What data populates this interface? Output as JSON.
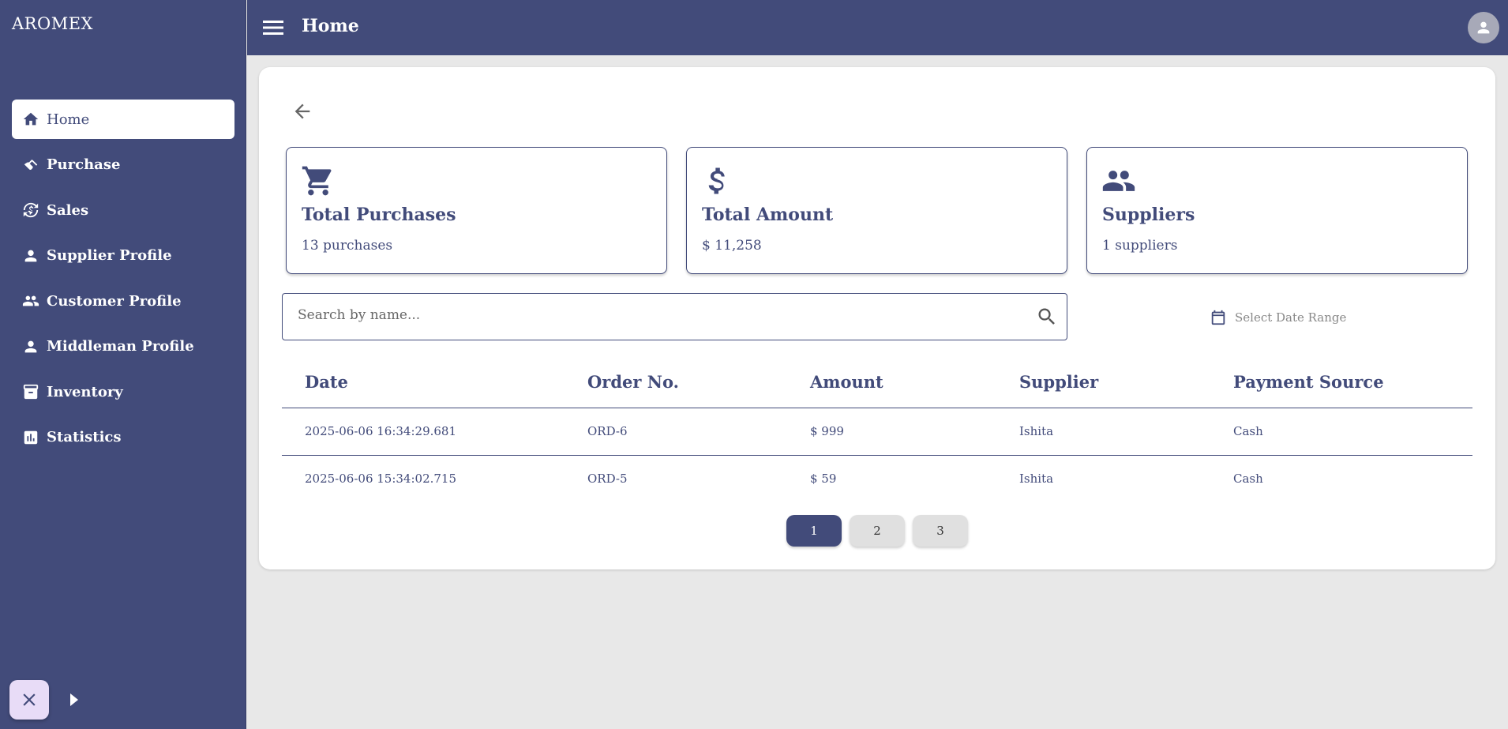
{
  "app": {
    "brand": "AROMEX"
  },
  "header": {
    "title": "Home"
  },
  "sidebar": {
    "items": [
      {
        "label": "Home",
        "icon": "home-icon",
        "active": true
      },
      {
        "label": "Purchase",
        "icon": "handshake-icon"
      },
      {
        "label": "Sales",
        "icon": "currency-exchange-icon"
      },
      {
        "label": "Supplier Profile",
        "icon": "person-icon"
      },
      {
        "label": "Customer Profile",
        "icon": "people-icon"
      },
      {
        "label": "Middleman Profile",
        "icon": "person-icon"
      },
      {
        "label": "Inventory",
        "icon": "inventory-icon"
      },
      {
        "label": "Statistics",
        "icon": "bar-chart-icon"
      }
    ]
  },
  "stats": [
    {
      "title": "Total Purchases",
      "value": "13 purchases",
      "icon": "cart-icon"
    },
    {
      "title": "Total Amount",
      "value": "$ 11,258",
      "icon": "dollar-icon"
    },
    {
      "title": "Suppliers",
      "value": "1 suppliers",
      "icon": "people-icon"
    }
  ],
  "search": {
    "placeholder": "Search by name..."
  },
  "date_range": {
    "placeholder": "Select Date Range"
  },
  "table": {
    "columns": [
      "Date",
      "Order No.",
      "Amount",
      "Supplier",
      "Payment Source"
    ],
    "rows": [
      {
        "date": "2025-06-06 16:34:29.681",
        "order": "ORD-6",
        "amount": "$ 999",
        "supplier": "Ishita",
        "source": "Cash"
      },
      {
        "date": "2025-06-06 15:34:02.715",
        "order": "ORD-5",
        "amount": "$ 59",
        "supplier": "Ishita",
        "source": "Cash"
      }
    ]
  },
  "pagination": {
    "pages": [
      "1",
      "2",
      "3"
    ],
    "current": "1"
  },
  "colors": {
    "primary": "#424b7a",
    "background": "#e8e8e8",
    "fab": "#e8dcf7"
  }
}
